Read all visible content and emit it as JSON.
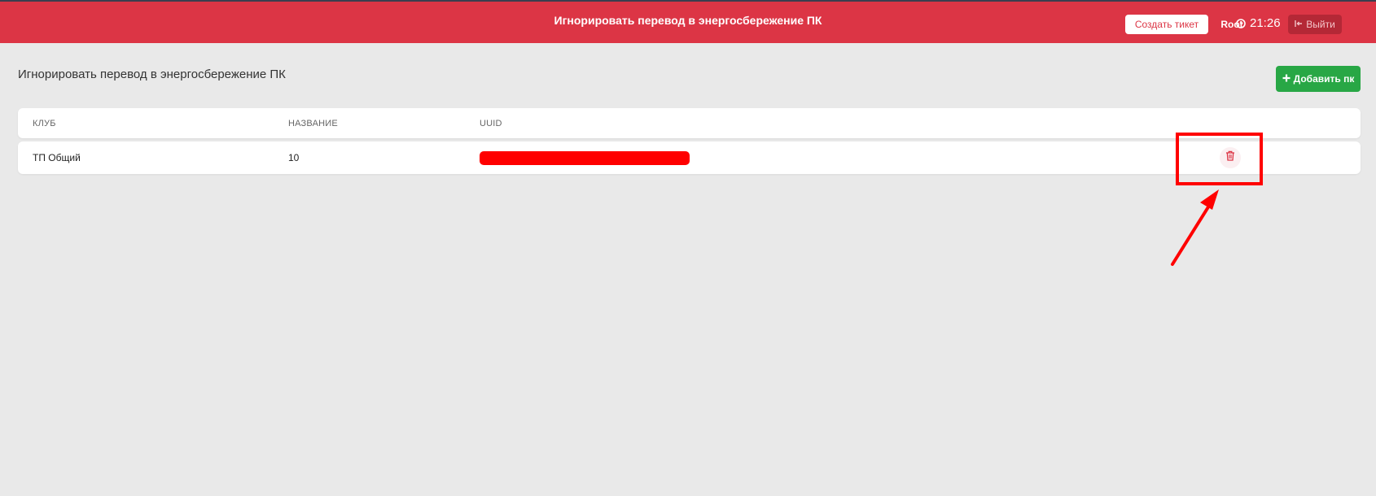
{
  "header": {
    "title": "Игнорировать перевод в энергосбережение ПК",
    "create_ticket_label": "Создать тикет",
    "user": "Root",
    "time": "21:26",
    "logout_label": "Выйти"
  },
  "main": {
    "title": "Игнорировать перевод в энергосбережение ПК",
    "add_pc_label": "Добавить пк"
  },
  "table": {
    "columns": [
      "КЛУБ",
      "НАЗВАНИЕ",
      "UUID"
    ],
    "rows": [
      {
        "club": "ТП Общий",
        "name": "10",
        "uuid": ""
      }
    ]
  },
  "colors": {
    "header_bg": "#dc3545",
    "add_button": "#28a745",
    "annotation": "#ff0000"
  },
  "icons": {
    "clock": "clock-icon",
    "logout": "logout-icon",
    "add": "plus-icon",
    "delete": "trash-icon"
  }
}
